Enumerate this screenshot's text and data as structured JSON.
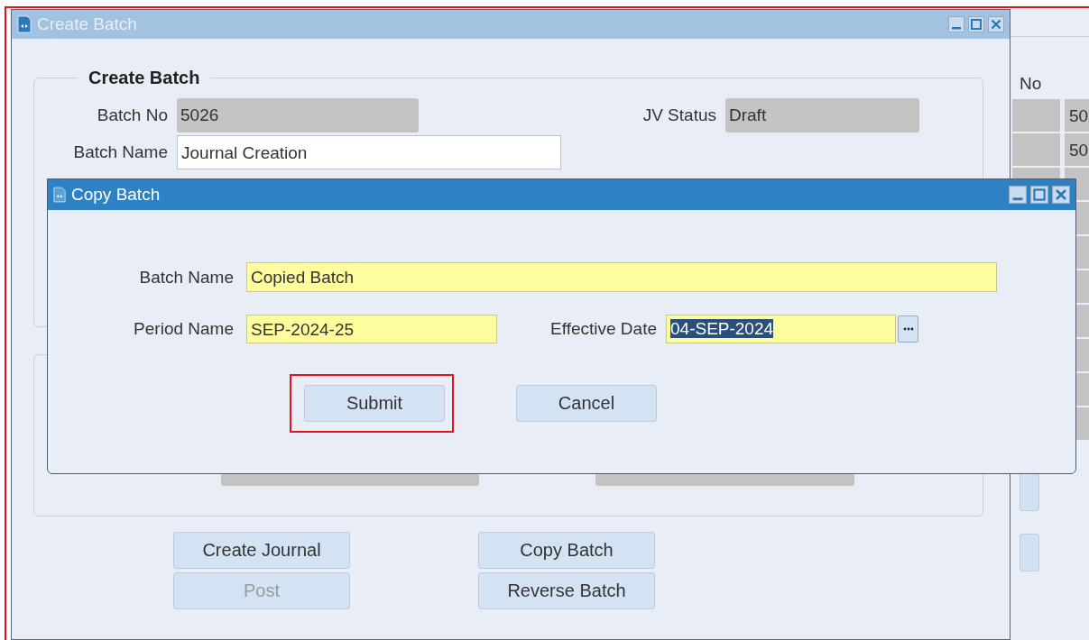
{
  "background_list": {
    "header": "No",
    "values": [
      "50",
      "50"
    ]
  },
  "main_window": {
    "title": "Create Batch",
    "active": false,
    "group_title": "Create Batch",
    "fields": [
      {
        "label": "Batch No",
        "value": "5026",
        "readonly": true
      },
      {
        "label": "JV Status",
        "value": "Draft",
        "readonly": true
      },
      {
        "label": "Batch Name",
        "value": "Journal Creation",
        "readonly": false
      }
    ],
    "buttons": [
      {
        "label": "Create Journal",
        "disabled": false
      },
      {
        "label": "Copy Batch",
        "disabled": false
      },
      {
        "label": "Post",
        "disabled": true
      },
      {
        "label": "Reverse Batch",
        "disabled": false
      }
    ]
  },
  "dialog": {
    "title": "Copy Batch",
    "active": true,
    "fields": [
      {
        "label": "Batch Name",
        "value": "Copied Batch",
        "required": true
      },
      {
        "label": "Period Name",
        "value": "SEP-2024-25",
        "required": true
      },
      {
        "label": "Effective Date",
        "value": "04-SEP-2024",
        "required": true,
        "text_selected": true
      }
    ],
    "buttons": [
      {
        "label": "Submit",
        "highlighted": true
      },
      {
        "label": "Cancel",
        "highlighted": false
      }
    ]
  }
}
